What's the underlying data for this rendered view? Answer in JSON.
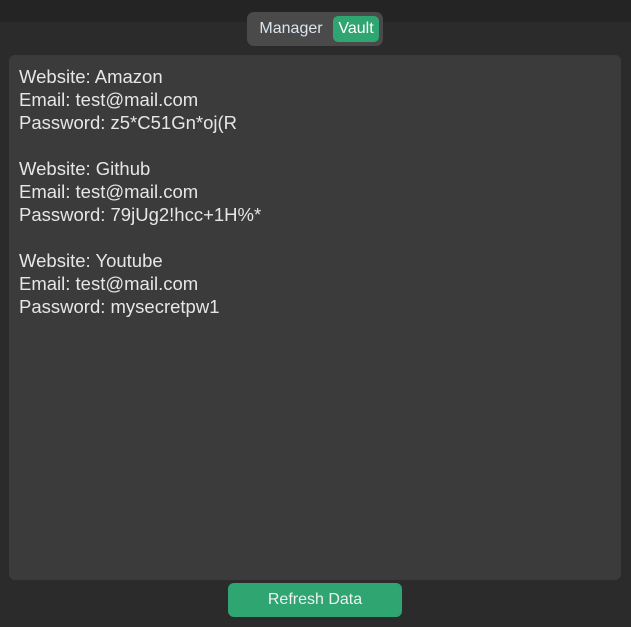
{
  "tabs": {
    "items": [
      {
        "label": "Manager",
        "selected": false
      },
      {
        "label": "Vault",
        "selected": true
      }
    ]
  },
  "vault": {
    "entries": [
      {
        "website_label": "Website: ",
        "website": "Amazon",
        "email_label": "Email: ",
        "email": "test@mail.com",
        "password_label": "Password: ",
        "password": "z5*C51Gn*oj(R"
      },
      {
        "website_label": "Website: ",
        "website": "Github",
        "email_label": "Email: ",
        "email": "test@mail.com",
        "password_label": "Password: ",
        "password": "79jUg2!hcc+1H%*"
      },
      {
        "website_label": "Website: ",
        "website": "Youtube",
        "email_label": "Email: ",
        "email": "test@mail.com",
        "password_label": "Password: ",
        "password": "mysecretpw1"
      }
    ]
  },
  "actions": {
    "refresh_label": "Refresh Data"
  },
  "colors": {
    "accent": "#2fa572",
    "background": "#242424",
    "panel": "#2b2b2b",
    "textbox": "#3b3b3b",
    "text": "#e6e6e6"
  }
}
